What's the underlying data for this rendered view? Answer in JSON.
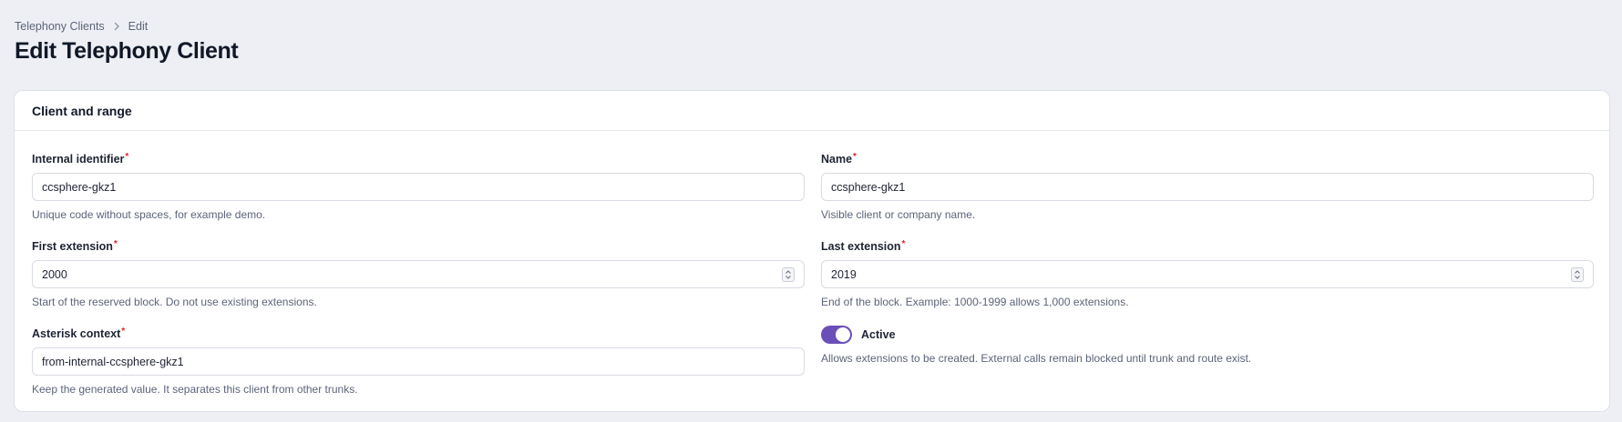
{
  "breadcrumb": {
    "parent": "Telephony Clients",
    "current": "Edit"
  },
  "page": {
    "title": "Edit Telephony Client"
  },
  "section": {
    "title": "Client and range"
  },
  "fields": {
    "internal_identifier": {
      "label": "Internal identifier",
      "required_mark": "*",
      "value": "ccsphere-gkz1",
      "help": "Unique code without spaces, for example demo."
    },
    "name": {
      "label": "Name",
      "required_mark": "*",
      "value": "ccsphere-gkz1",
      "help": "Visible client or company name."
    },
    "first_extension": {
      "label": "First extension",
      "required_mark": "*",
      "value": "2000",
      "help": "Start of the reserved block. Do not use existing extensions."
    },
    "last_extension": {
      "label": "Last extension",
      "required_mark": "*",
      "value": "2019",
      "help": "End of the block. Example: 1000-1999 allows 1,000 extensions."
    },
    "asterisk_context": {
      "label": "Asterisk context",
      "required_mark": "*",
      "value": "from-internal-ccsphere-gkz1",
      "help": "Keep the generated value. It separates this client from other trunks."
    },
    "active": {
      "label": "Active",
      "checked": true,
      "help": "Allows extensions to be created. External calls remain blocked until trunk and route exist."
    }
  },
  "colors": {
    "accent": "#6b4fb8",
    "required": "#e02424",
    "background": "#eeeff4"
  },
  "icons": {
    "breadcrumb_separator": "chevron-right-icon",
    "stepper": "up-down-arrows-icon"
  }
}
